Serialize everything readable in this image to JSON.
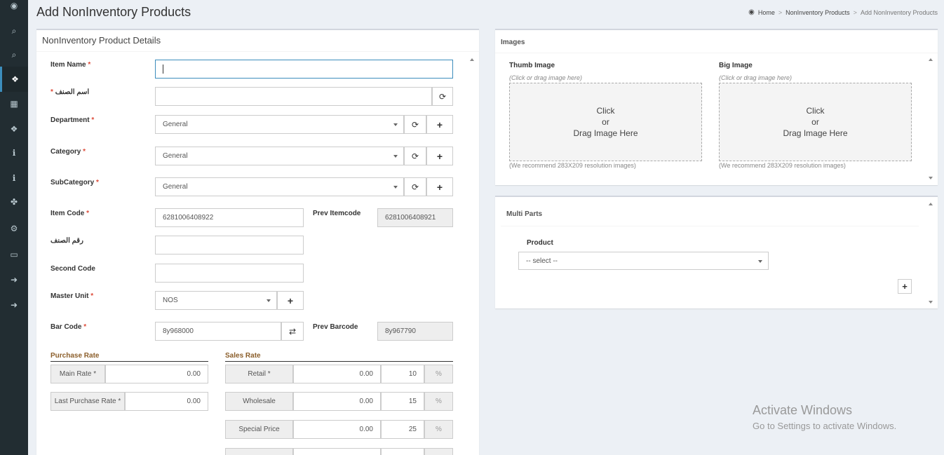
{
  "sidebar": {
    "icons": [
      "dashboard-icon",
      "search-icon",
      "search-icon",
      "cubes-icon",
      "calculator-icon",
      "cubes-icon",
      "info-icon",
      "info-icon",
      "puzzle-icon",
      "cogs-icon",
      "laptop-icon",
      "sign-out-icon",
      "sign-out-icon"
    ]
  },
  "header": {
    "title": "Add NonInventory Products"
  },
  "breadcrumb": {
    "home": "Home",
    "section": "NonInventory Products",
    "current": "Add NonInventory Products",
    "sep": ">"
  },
  "details": {
    "title": "NonInventory Product Details",
    "item_name_label": "Item Name",
    "arabic_name_label": "اسم الصنف",
    "department_label": "Department",
    "department_value": "General",
    "category_label": "Category",
    "category_value": "General",
    "subcategory_label": "SubCategory",
    "subcategory_value": "General",
    "item_code_label": "Item Code",
    "item_code_value": "6281006408922",
    "prev_itemcode_label": "Prev Itemcode",
    "prev_itemcode_value": "6281006408921",
    "arabic_code_label": "رقم الصنف",
    "second_code_label": "Second Code",
    "master_unit_label": "Master Unit",
    "master_unit_value": "NOS",
    "bar_code_label": "Bar Code",
    "bar_code_value": "8y968000",
    "prev_barcode_label": "Prev Barcode",
    "prev_barcode_value": "8y967790",
    "req_mark": "*",
    "plus": "+",
    "refresh": "⟳",
    "swap": "⇄"
  },
  "purchase": {
    "title": "Purchase Rate",
    "main_rate_label": "Main Rate",
    "main_rate_value": "0.00",
    "last_rate_label": "Last Purchase Rate",
    "last_rate_value": "0.00"
  },
  "sales": {
    "title": "Sales Rate",
    "pct": "%",
    "rows": [
      {
        "label": "Retail",
        "value": "0.00",
        "percent": "10",
        "required": "*"
      },
      {
        "label": "Wholesale",
        "value": "0.00",
        "percent": "15"
      },
      {
        "label": "Special Price",
        "value": "0.00",
        "percent": "25"
      }
    ]
  },
  "images": {
    "title": "Images",
    "thumb_label": "Thumb Image",
    "big_label": "Big Image",
    "hint": "(Click or drag image here)",
    "drop_line1": "Click",
    "drop_line2": "or",
    "drop_line3": "Drag Image Here",
    "recommend": "(We recommend 283X209 resolution images)"
  },
  "multi_parts": {
    "title": "Multi Parts",
    "product_label": "Product",
    "product_placeholder": "-- select --",
    "plus": "+"
  },
  "watermark": {
    "line1": "Activate Windows",
    "line2": "Go to Settings to activate Windows."
  },
  "colors": {
    "sidebar": "#222d32",
    "accent": "#3c8dbc",
    "section": "#8b5e2a",
    "required": "#dd4b39"
  }
}
